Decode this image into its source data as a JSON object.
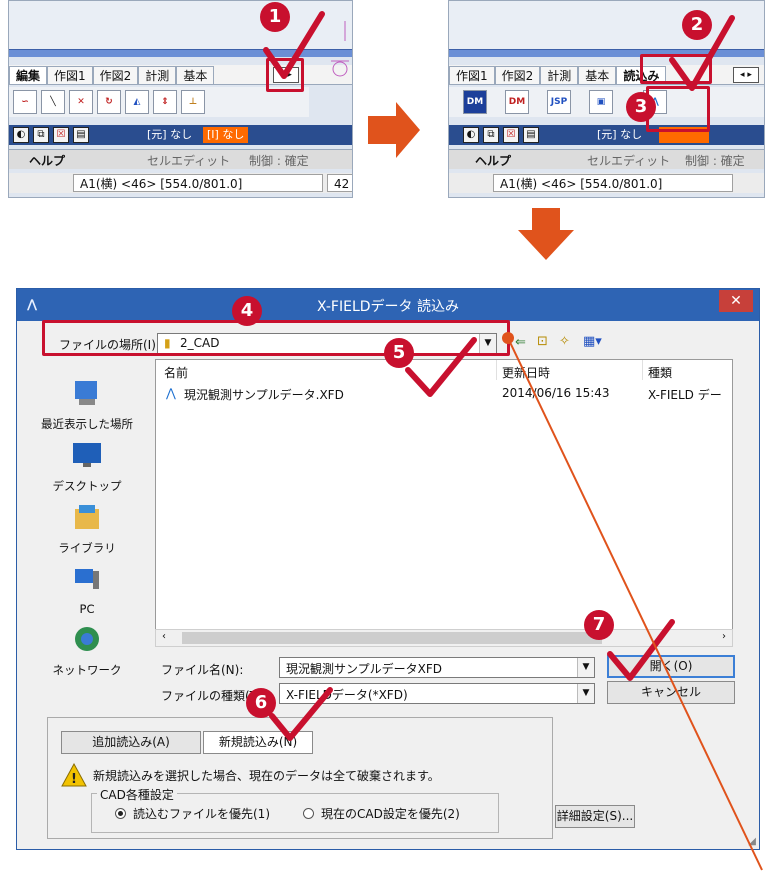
{
  "colors": {
    "accent_red": "#c8102e",
    "arrow_orange": "#e0531c",
    "title_blue": "#2e64b4"
  },
  "step_numbers": [
    "1",
    "2",
    "3",
    "4",
    "5",
    "6",
    "7"
  ],
  "left_panel": {
    "tabs": [
      "編集",
      "作図1",
      "作図2",
      "計測",
      "基本"
    ],
    "layer_original": "[元] なし",
    "layer_current": "[I] なし",
    "help_label": "ヘルプ",
    "mode_label": "セルエディット",
    "control_label": "制御 : 確定",
    "status": "A1(横) <46> [554.0/801.0]",
    "status_extra": "42"
  },
  "right_panel": {
    "tabs": [
      "作図1",
      "作図2",
      "計測",
      "基本",
      "読込み"
    ],
    "tools": [
      "DM",
      "DM",
      "JSP"
    ],
    "layer_original": "[元] なし",
    "help_label": "ヘルプ",
    "mode_label": "セルエディット",
    "control_label": "制御 : 確定",
    "status": "A1(横) <46> [554.0/801.0]"
  },
  "dialog": {
    "title": "X-FIELDデータ 読込み",
    "look_in_label": "ファイルの場所(I):",
    "look_in_value": "2_CAD",
    "places": [
      "最近表示した場所",
      "デスクトップ",
      "ライブラリ",
      "PC",
      "ネットワーク"
    ],
    "columns": [
      "名前",
      "更新日時",
      "種類"
    ],
    "files": [
      {
        "name": "現況観測サンプルデータ.XFD",
        "date": "2014/06/16 15:43",
        "type": "X-FIELD デー"
      }
    ],
    "filename_label": "ファイル名(N):",
    "filename_value": "現況観測サンプルデータXFD",
    "filetype_label": "ファイルの種類(T):",
    "filetype_value": "X-FIELDデータ(*XFD)",
    "open_button": "開く(O)",
    "cancel_button": "キャンセル",
    "add_read_button": "追加読込み(A)",
    "new_read_button": "新規読込み(N)",
    "warning": "新規読込みを選択した場合、現在のデータは全て破棄されます。",
    "cad_group_title": "CAD各種設定",
    "radio_file_priority": "読込むファイルを優先(1)",
    "radio_current_priority": "現在のCAD設定を優先(2)",
    "detail_button": "詳細設定(S)..."
  }
}
